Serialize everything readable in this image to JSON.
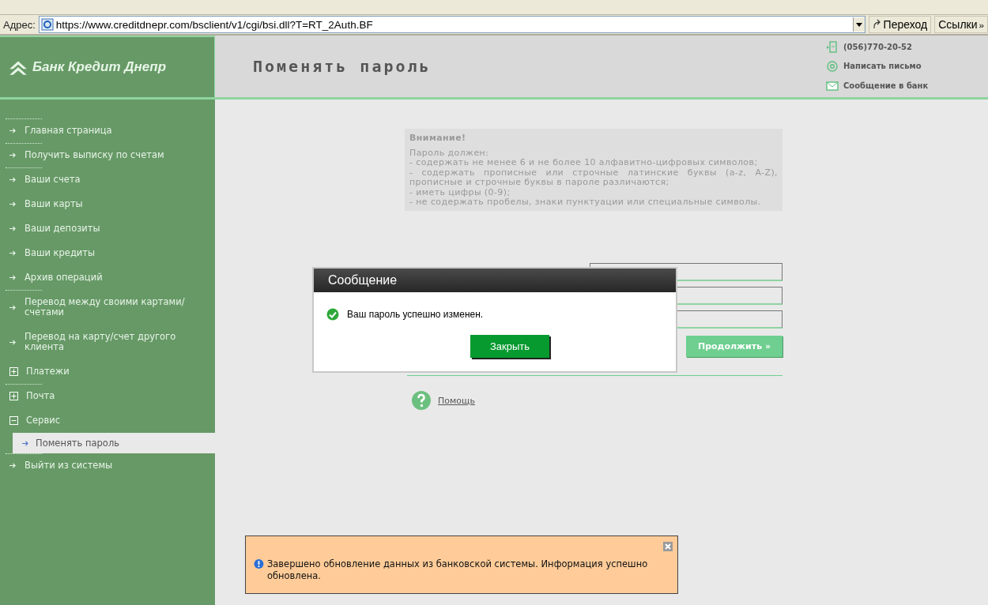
{
  "browser": {
    "address_label": "Адрес:",
    "url": "https://www.creditdnepr.com/bsclient/v1/cgi/bsi.dll?T=RT_2Auth.BF",
    "go_button": "Переход",
    "links_button": "Ссылки",
    "more": "»"
  },
  "header": {
    "logo": "Банк Кредит Днепр",
    "title": "Поменять пароль",
    "contacts": [
      {
        "kind": "phone",
        "text": "(056)770-20-52"
      },
      {
        "kind": "email",
        "text": "Написать письмо"
      },
      {
        "kind": "message",
        "text": "Сообщение в банк"
      }
    ]
  },
  "sidebar": {
    "items": [
      {
        "kind": "link",
        "label": "Главная страница",
        "divider_above": true
      },
      {
        "kind": "link",
        "label": "Получить выписку по счетам",
        "divider_above": true
      },
      {
        "kind": "link",
        "label": "Ваши счета",
        "divider_above": true
      },
      {
        "kind": "link",
        "label": "Ваши карты",
        "divider_above": false
      },
      {
        "kind": "link",
        "label": "Ваши депозиты",
        "divider_above": false
      },
      {
        "kind": "link",
        "label": "Ваши кредиты",
        "divider_above": false
      },
      {
        "kind": "link",
        "label": "Архив операций",
        "divider_above": false
      },
      {
        "kind": "link",
        "label": "Перевод между своими картами/счетами",
        "divider_above": true
      },
      {
        "kind": "link",
        "label": "Перевод на карту/счет другого клиента",
        "divider_above": false
      },
      {
        "kind": "group",
        "label": "Платежи",
        "expanded": false,
        "divider_above": false
      },
      {
        "kind": "group",
        "label": "Почта",
        "expanded": false,
        "divider_above": true
      },
      {
        "kind": "group",
        "label": "Сервис",
        "expanded": true,
        "divider_above": false,
        "children": [
          {
            "label": "Поменять пароль",
            "selected": true
          }
        ]
      },
      {
        "kind": "link",
        "label": "Выйти из системы",
        "divider_above": true
      }
    ]
  },
  "notice": {
    "title": "Внимание!",
    "intro": "Пароль должен:",
    "rules": [
      "- содержать не менее 6 и не более 10 алфавитно-цифровых символов;",
      "- содержать прописные или строчные латинские буквы (a-z, A-Z), прописные и строчные буквы в пароле различаются;",
      "- иметь цифры (0-9);",
      "- не содержать пробелы, знаки пунктуации или специальные символы."
    ]
  },
  "form": {
    "continue_button": "Продолжить »",
    "help_link": "Помощь"
  },
  "dialog": {
    "title": "Сообщение",
    "message": "Ваш пароль успешно изменен.",
    "close_button": "Закрыть"
  },
  "toast": {
    "message": "Завершено обновление данных из банковской системы. Информация успешно обновлена."
  }
}
